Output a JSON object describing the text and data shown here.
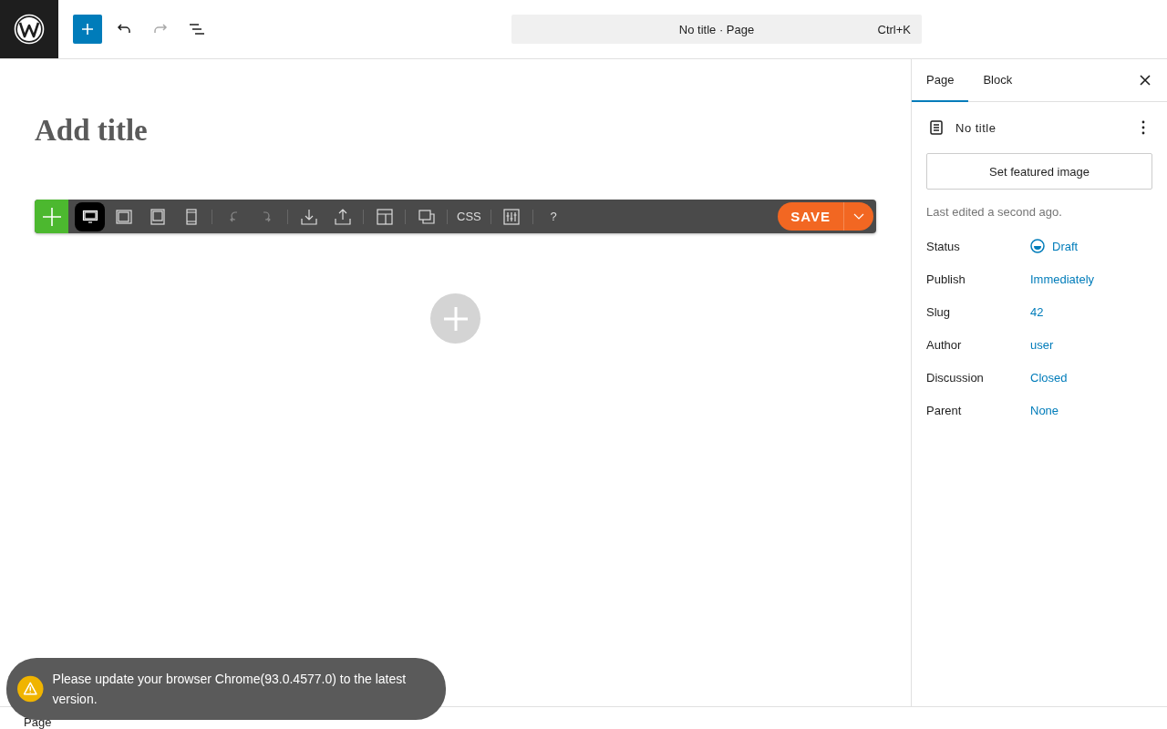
{
  "header": {
    "command_bar": {
      "title": "No title · Page",
      "shortcut": "Ctrl+K"
    },
    "undo_disabled": false,
    "redo_disabled": true
  },
  "editor": {
    "title_placeholder": "Add title",
    "builder_toolbar": {
      "items": [
        {
          "kind": "desktop",
          "selected": true
        },
        {
          "kind": "landscape",
          "selected": false
        },
        {
          "kind": "tablet",
          "selected": false
        },
        {
          "kind": "phone",
          "selected": false
        },
        {
          "kind": "sep"
        },
        {
          "kind": "undo",
          "disabled": true
        },
        {
          "kind": "redo",
          "disabled": true
        },
        {
          "kind": "sep"
        },
        {
          "kind": "download",
          "disabled": false
        },
        {
          "kind": "upload",
          "disabled": false
        },
        {
          "kind": "sep"
        },
        {
          "kind": "layout",
          "disabled": false
        },
        {
          "kind": "sep"
        },
        {
          "kind": "overlap",
          "disabled": false
        },
        {
          "kind": "sep"
        },
        {
          "kind": "text",
          "label": "CSS"
        },
        {
          "kind": "sep"
        },
        {
          "kind": "sliders",
          "disabled": false
        },
        {
          "kind": "sep"
        },
        {
          "kind": "text",
          "label": "?"
        }
      ],
      "save": "SAVE"
    }
  },
  "sidebar": {
    "tabs": [
      {
        "label": "Page",
        "selected": true
      },
      {
        "label": "Block",
        "selected": false
      }
    ],
    "doc_title": "No title",
    "featured_button": "Set featured image",
    "last_edited": "Last edited a second ago.",
    "fields": [
      {
        "label": "Status",
        "value": "Draft",
        "kind": "status"
      },
      {
        "label": "Publish",
        "value": "Immediately",
        "kind": "link"
      },
      {
        "label": "Slug",
        "value": "42",
        "kind": "link"
      },
      {
        "label": "Author",
        "value": "user",
        "kind": "link"
      },
      {
        "label": "Discussion",
        "value": "Closed",
        "kind": "link"
      },
      {
        "label": "Parent",
        "value": "None",
        "kind": "link"
      }
    ]
  },
  "footer": {
    "breadcrumb": "Page"
  },
  "notice": {
    "text": "Please update your browser Chrome(93.0.4577.0) to the latest version."
  }
}
